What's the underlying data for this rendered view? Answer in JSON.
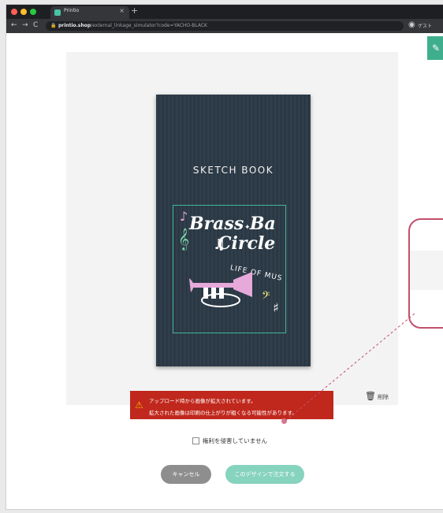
{
  "browser": {
    "tab_title": "Printio",
    "new_tab": "+",
    "tab_close": "×",
    "nav_back": "←",
    "nav_forward": "→",
    "nav_reload": "C",
    "url_host": "printio.shop",
    "url_path": "/external_linkage_simulator?code=YACHO-BLACK",
    "profile_label": "ゲスト",
    "traffic_lights": [
      "#ff5f57",
      "#febc2e",
      "#28c840"
    ]
  },
  "product": {
    "notebook_title": "SKETCH BOOK",
    "art_line1": "Brass Ba",
    "art_line2": "Circle",
    "art_line3": "LIFE OF MUS"
  },
  "warning": {
    "line1": "アップロード時から画像が拡大されています。",
    "line2": "拡大された画像は印刷の仕上がりが粗くなる可能性があります。",
    "color": "#c0281d"
  },
  "actions": {
    "delete_label": "削除",
    "rights_checkbox_label": "権利を侵害していません",
    "rights_checked": false,
    "cancel_label": "キャンセル",
    "order_label": "このデザインで注文する"
  },
  "colors": {
    "accent": "#3fae8c",
    "order_button": "#86d3be",
    "cancel_button": "#8e8e8e",
    "callout": "#c24f6c"
  }
}
